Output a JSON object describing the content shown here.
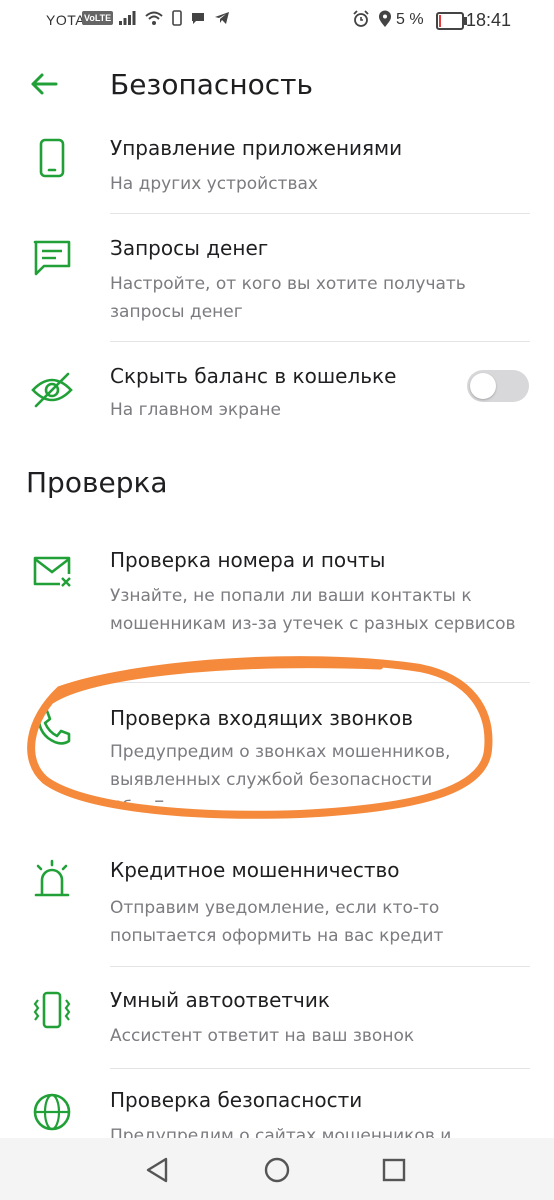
{
  "status_bar": {
    "carrier": "YOTA",
    "volte": "VoLTE",
    "battery_percent": "5 %",
    "battery_level": 0.05,
    "time": "18:41",
    "battery_color": "#e23b3b"
  },
  "header": {
    "title": "Безопасность",
    "back_icon": "arrow-left-icon"
  },
  "accent_color": "#21a038",
  "items_top": [
    {
      "icon": "phone-icon",
      "title": "Управление приложениями",
      "subtitle": "На других устройствах"
    },
    {
      "icon": "chat-icon",
      "title": "Запросы денег",
      "subtitle": "Настройте, от кого вы хотите получать запросы денег"
    },
    {
      "icon": "eye-off-icon",
      "title": "Скрыть баланс в кошельке",
      "subtitle": "На главном экране",
      "toggle": false
    }
  ],
  "section": {
    "title": "Проверка"
  },
  "items_check": [
    {
      "icon": "mail-alert-icon",
      "title": "Проверка номера и почты",
      "subtitle": "Узнайте, не попали ли ваши контакты к мошенникам из-за утечек с разных сервисов"
    },
    {
      "icon": "phone-call-icon",
      "title": "Проверка входящих звонков",
      "subtitle": "Предупредим о звонках мошенников, выявленных службой безопасности СберБанка"
    },
    {
      "icon": "siren-icon",
      "title": "Кредитное мошенничество",
      "subtitle": "Отправим уведомление, если кто-то попытается оформить на вас кредит"
    },
    {
      "icon": "phone-vibrate-icon",
      "title": "Умный автоответчик",
      "subtitle": "Ассистент ответит на ваш звонок"
    },
    {
      "icon": "globe-icon",
      "title": "Проверка безопасности",
      "subtitle": "Предупредим о сайтах мошенников и"
    }
  ],
  "annotation": {
    "color": "#f58a3c",
    "shape": "hand-drawn-ellipse"
  },
  "nav": {
    "back": "triangle-back-icon",
    "home": "circle-home-icon",
    "recent": "square-recent-icon"
  }
}
